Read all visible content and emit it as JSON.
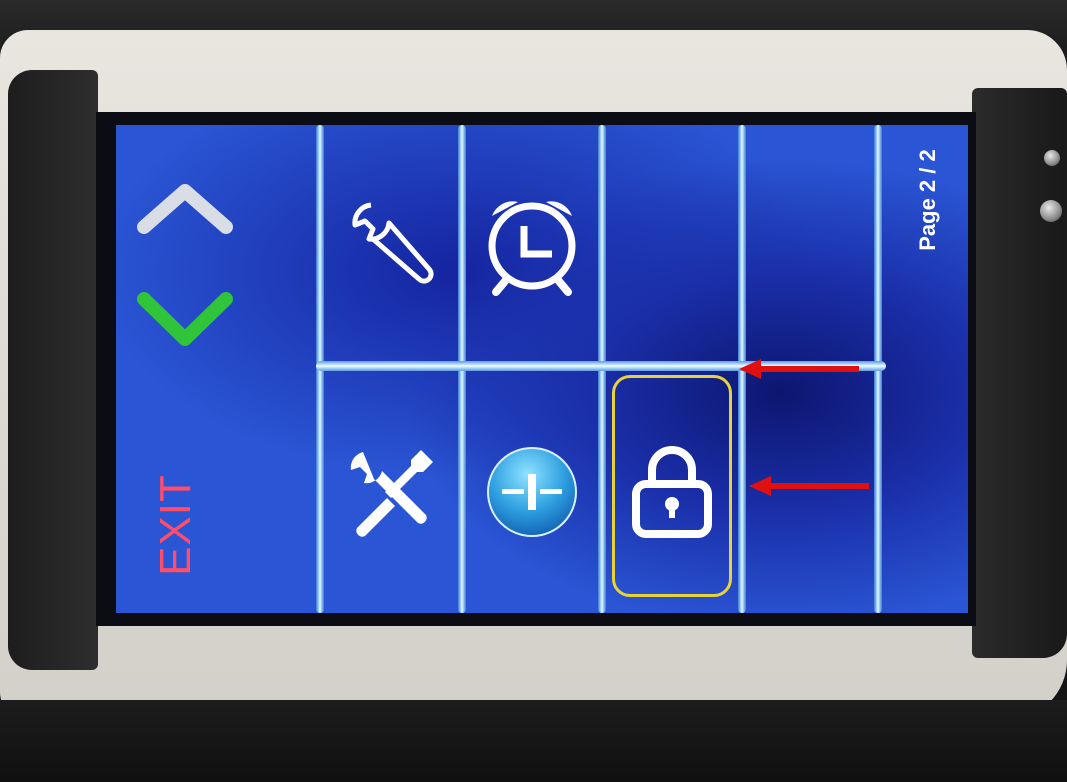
{
  "screen": {
    "page_indicator": "Page 2 / 2",
    "exit_label": "EXIT",
    "nav": {
      "up_icon": "chevron-up-icon",
      "down_icon": "chevron-down-icon",
      "down_color": "#2fc43a",
      "up_color": "#d9dde6"
    },
    "grid": {
      "row1": [
        {
          "icon": "wrench-icon"
        },
        {
          "icon": "alarm-clock-icon"
        },
        {
          "icon": "empty"
        },
        {
          "icon": "empty"
        }
      ],
      "row2": [
        {
          "icon": "tools-icon"
        },
        {
          "icon": "info-icon"
        },
        {
          "icon": "lock-icon",
          "selected": true
        },
        {
          "icon": "empty"
        }
      ]
    },
    "colors": {
      "background": "#2a55d4",
      "selection_border": "#e6d23a",
      "exit_text": "#ff4d6a",
      "annotation_arrow": "#e01010"
    }
  },
  "annotations": [
    {
      "type": "arrow",
      "points_to": "horizontal-divider"
    },
    {
      "type": "arrow",
      "points_to": "lock-button"
    }
  ]
}
